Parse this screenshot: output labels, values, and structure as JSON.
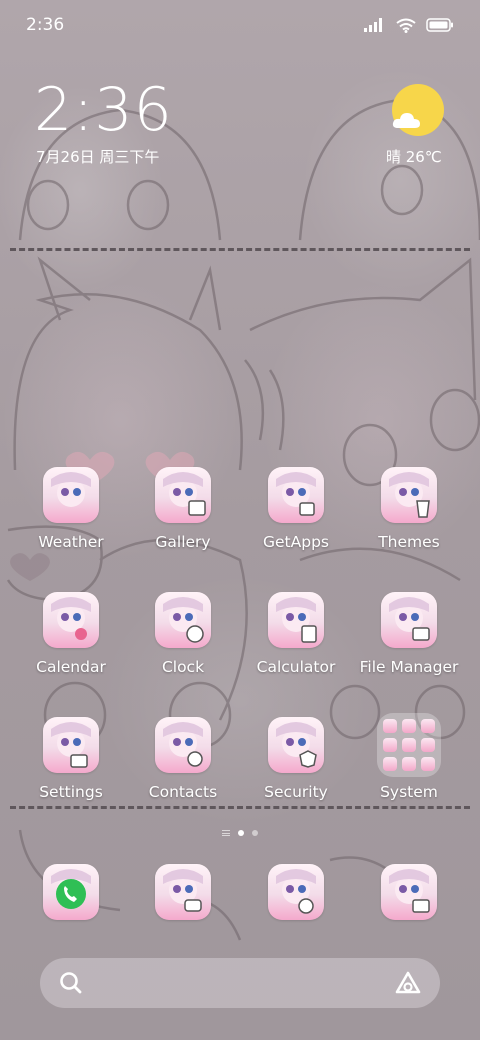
{
  "status_bar": {
    "time": "2:36",
    "icons": [
      "signal-icon",
      "wifi-icon",
      "battery-icon"
    ]
  },
  "clock_widget": {
    "time": "2:36",
    "date": "7月26日 周三下午"
  },
  "weather_widget": {
    "text": "晴 26℃",
    "icon": "sun-cloud-icon"
  },
  "apps": [
    {
      "label": "Weather",
      "badge": "weather-icon"
    },
    {
      "label": "Gallery",
      "badge": "gallery-icon"
    },
    {
      "label": "GetApps",
      "badge": "getapps-icon"
    },
    {
      "label": "Themes",
      "badge": "themes-icon"
    },
    {
      "label": "Calendar",
      "badge": "calendar-icon"
    },
    {
      "label": "Clock",
      "badge": "clock-icon"
    },
    {
      "label": "Calculator",
      "badge": "calculator-icon"
    },
    {
      "label": "File Manager",
      "badge": "file-manager-icon"
    },
    {
      "label": "Settings",
      "badge": "settings-icon"
    },
    {
      "label": "Contacts",
      "badge": "contacts-icon"
    },
    {
      "label": "Security",
      "badge": "security-icon"
    },
    {
      "label": "System",
      "badge": "folder-icon"
    }
  ],
  "dock": [
    {
      "badge": "phone-icon"
    },
    {
      "badge": "messages-icon"
    },
    {
      "badge": "browser-icon"
    },
    {
      "badge": "camera-icon"
    }
  ],
  "page_indicator": {
    "pages": 2,
    "active": 1
  },
  "colors": {
    "sun": "#f7d64a",
    "phone_green": "#2fbf55",
    "icon_pink": "#f4a9cc"
  }
}
